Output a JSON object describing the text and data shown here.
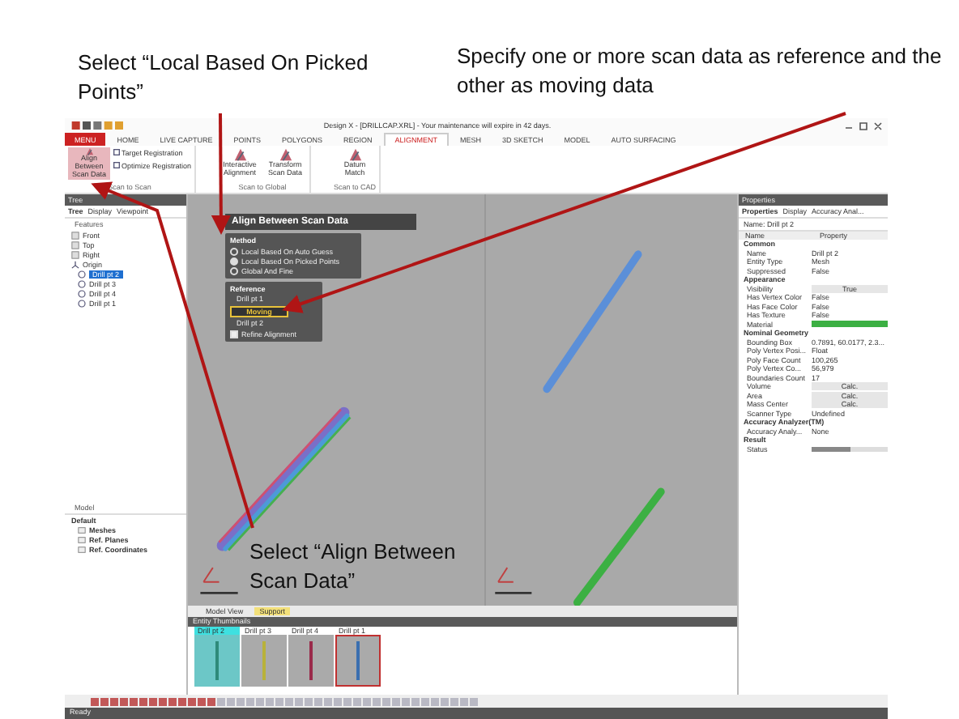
{
  "callouts": [
    {
      "text": "Select “Local Based On Picked Points”"
    },
    {
      "text": "Specify one or more scan data as reference and the other as moving data"
    },
    {
      "text": "Select “Align Between Scan Data”"
    }
  ],
  "app": {
    "title": "Design X - [DRILLCAP.XRL] - Your maintenance will expire in 42 days.",
    "ribbon_tabs": [
      {
        "label": "MENU",
        "selected": false,
        "kind": "menu"
      },
      {
        "label": "HOME",
        "selected": false,
        "kind": "tab"
      },
      {
        "label": "LIVE CAPTURE",
        "selected": false,
        "kind": "tab"
      },
      {
        "label": "POINTS",
        "selected": false,
        "kind": "tab"
      },
      {
        "label": "POLYGONS",
        "selected": false,
        "kind": "tab"
      },
      {
        "label": "REGION",
        "selected": false,
        "kind": "tab"
      },
      {
        "label": "ALIGNMENT",
        "selected": true,
        "kind": "tab"
      },
      {
        "label": "MESH",
        "selected": false,
        "kind": "tab"
      },
      {
        "label": "3D SKETCH",
        "selected": false,
        "kind": "tab"
      },
      {
        "label": "MODEL",
        "selected": false,
        "kind": "tab"
      },
      {
        "label": "AUTO SURFACING",
        "selected": false,
        "kind": "tab"
      }
    ],
    "ribbon_groups": [
      {
        "label": "Scan to Scan",
        "commands": [
          {
            "label": "Align Between Scan Data",
            "kind": "large",
            "selected": true
          },
          {
            "label": "Target Registration",
            "kind": "small",
            "selected": false
          },
          {
            "label": "Optimize Registration",
            "kind": "small",
            "selected": false
          }
        ]
      },
      {
        "label": "Scan to Global",
        "commands": [
          {
            "label": "Interactive Alignment",
            "kind": "large",
            "selected": false
          },
          {
            "label": "Transform Scan Data",
            "kind": "large",
            "selected": false
          }
        ]
      },
      {
        "label": "Scan to CAD",
        "commands": [
          {
            "label": "Datum Match",
            "kind": "large",
            "selected": false
          }
        ]
      }
    ],
    "tree": {
      "title": "Tree",
      "tabs": [
        {
          "label": "Tree",
          "selected": true
        },
        {
          "label": "Display",
          "selected": false
        },
        {
          "label": "Viewpoint",
          "selected": false
        }
      ],
      "heading": "Features",
      "items": [
        {
          "label": "Front",
          "kind": "plane",
          "selected": false
        },
        {
          "label": "Top",
          "kind": "plane",
          "selected": false
        },
        {
          "label": "Right",
          "kind": "plane",
          "selected": false
        },
        {
          "label": "Origin",
          "kind": "axes",
          "selected": false
        },
        {
          "label": "Drill pt 2",
          "kind": "mesh",
          "selected": true
        },
        {
          "label": "Drill pt 3",
          "kind": "mesh",
          "selected": false
        },
        {
          "label": "Drill pt 4",
          "kind": "mesh",
          "selected": false
        },
        {
          "label": "Drill pt 1",
          "kind": "mesh",
          "selected": false
        }
      ]
    },
    "model": {
      "heading": "Model",
      "root": "Default",
      "children": [
        {
          "label": "Meshes"
        },
        {
          "label": "Ref. Planes"
        },
        {
          "label": "Ref. Coordinates"
        }
      ]
    },
    "dialog": {
      "title": "Align Between Scan Data",
      "method": {
        "heading": "Method",
        "options": [
          {
            "label": "Local Based On Auto Guess",
            "selected": false
          },
          {
            "label": "Local Based On Picked Points",
            "selected": true
          },
          {
            "label": "Global And Fine",
            "selected": false
          }
        ]
      },
      "reference": {
        "heading": "Reference",
        "value": "Drill pt 1",
        "moving_label": "Moving",
        "moving_value": "Drill pt 2",
        "refine": {
          "label": "Refine Alignment",
          "checked": true
        }
      }
    },
    "view_tabs": [
      {
        "label": "Model View",
        "selected": false
      },
      {
        "label": "Support",
        "selected": true
      }
    ],
    "thumbnails": {
      "title": "Entity Thumbnails",
      "items": [
        {
          "label": "Drill pt 2",
          "selected": true,
          "outlined": false,
          "color": "#2e8a7a"
        },
        {
          "label": "Drill pt 3",
          "selected": false,
          "outlined": false,
          "color": "#b8b23a"
        },
        {
          "label": "Drill pt 4",
          "selected": false,
          "outlined": false,
          "color": "#9a2a4a"
        },
        {
          "label": "Drill pt 1",
          "selected": false,
          "outlined": true,
          "color": "#3a6fb0"
        }
      ]
    },
    "status": "Ready",
    "properties": {
      "title": "Properties",
      "tabs": [
        {
          "label": "Properties",
          "selected": true
        },
        {
          "label": "Display",
          "selected": false
        },
        {
          "label": "Accuracy Anal...",
          "selected": false
        }
      ],
      "name_label": "Name: Drill pt 2",
      "columns": [
        "Name",
        "Property"
      ],
      "sections": [
        {
          "heading": "Common",
          "rows": [
            {
              "name": "Name",
              "kind": "text",
              "value": "Drill pt 2"
            },
            {
              "name": "Entity Type",
              "kind": "text",
              "value": "Mesh"
            },
            {
              "name": "Suppressed",
              "kind": "text",
              "value": "False"
            }
          ]
        },
        {
          "heading": "Appearance",
          "rows": [
            {
              "name": "Visibility",
              "kind": "button",
              "value": "True"
            },
            {
              "name": "Has Vertex Color",
              "kind": "text",
              "value": "False"
            },
            {
              "name": "Has Face Color",
              "kind": "text",
              "value": "False"
            },
            {
              "name": "Has Texture",
              "kind": "text",
              "value": "False"
            },
            {
              "name": "Material",
              "kind": "swatch",
              "color": "#3cb043"
            }
          ]
        },
        {
          "heading": "Nominal Geometry",
          "rows": [
            {
              "name": "Bounding Box",
              "kind": "text",
              "value": "0.7891, 60.0177, 2.3..."
            },
            {
              "name": "Poly Vertex Posi...",
              "kind": "text",
              "value": "Float"
            },
            {
              "name": "Poly Face Count",
              "kind": "text",
              "value": "100,265"
            },
            {
              "name": "Poly Vertex Co...",
              "kind": "text",
              "value": "56,979"
            },
            {
              "name": "Boundaries Count",
              "kind": "text",
              "value": "17"
            },
            {
              "name": "Volume",
              "kind": "button",
              "value": "Calc."
            },
            {
              "name": "Area",
              "kind": "button",
              "value": "Calc."
            },
            {
              "name": "Mass Center",
              "kind": "button",
              "value": "Calc."
            },
            {
              "name": "Scanner Type",
              "kind": "text",
              "value": "Undefined"
            }
          ]
        },
        {
          "heading": "Accuracy Analyzer(TM)",
          "rows": [
            {
              "name": "Accuracy Analy...",
              "kind": "text",
              "value": "None"
            }
          ]
        },
        {
          "heading": "Result",
          "rows": [
            {
              "name": "Status",
              "kind": "slider",
              "level": 0.5
            }
          ]
        }
      ]
    }
  }
}
